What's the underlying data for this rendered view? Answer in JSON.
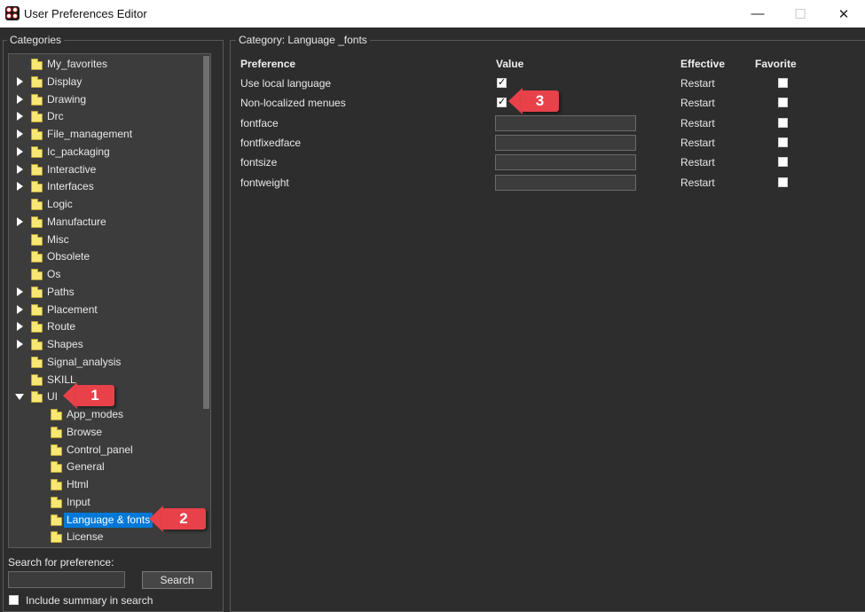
{
  "window": {
    "title": "User Preferences Editor",
    "minimize_glyph": "—",
    "maximize_glyph": "☐",
    "close_glyph": "✕"
  },
  "left_panel": {
    "group_title": "Categories",
    "tree": [
      {
        "label": "My_favorites",
        "expander": "none",
        "level": 0
      },
      {
        "label": "Display",
        "expander": "collapsed",
        "level": 0
      },
      {
        "label": "Drawing",
        "expander": "collapsed",
        "level": 0
      },
      {
        "label": "Drc",
        "expander": "collapsed",
        "level": 0
      },
      {
        "label": "File_management",
        "expander": "collapsed",
        "level": 0
      },
      {
        "label": "Ic_packaging",
        "expander": "collapsed",
        "level": 0
      },
      {
        "label": "Interactive",
        "expander": "collapsed",
        "level": 0
      },
      {
        "label": "Interfaces",
        "expander": "collapsed",
        "level": 0
      },
      {
        "label": "Logic",
        "expander": "none",
        "level": 0
      },
      {
        "label": "Manufacture",
        "expander": "collapsed",
        "level": 0
      },
      {
        "label": "Misc",
        "expander": "none",
        "level": 0
      },
      {
        "label": "Obsolete",
        "expander": "none",
        "level": 0
      },
      {
        "label": "Os",
        "expander": "none",
        "level": 0
      },
      {
        "label": "Paths",
        "expander": "collapsed",
        "level": 0
      },
      {
        "label": "Placement",
        "expander": "collapsed",
        "level": 0
      },
      {
        "label": "Route",
        "expander": "collapsed",
        "level": 0
      },
      {
        "label": "Shapes",
        "expander": "collapsed",
        "level": 0
      },
      {
        "label": "Signal_analysis",
        "expander": "none",
        "level": 0
      },
      {
        "label": "SKILL",
        "expander": "none",
        "level": 0
      },
      {
        "label": "UI",
        "expander": "expanded",
        "level": 0
      },
      {
        "label": "App_modes",
        "expander": "none",
        "level": 1
      },
      {
        "label": "Browse",
        "expander": "none",
        "level": 1
      },
      {
        "label": "Control_panel",
        "expander": "none",
        "level": 1
      },
      {
        "label": "General",
        "expander": "none",
        "level": 1
      },
      {
        "label": "Html",
        "expander": "none",
        "level": 1
      },
      {
        "label": "Input",
        "expander": "none",
        "level": 1
      },
      {
        "label": "Language & fonts",
        "expander": "none",
        "level": 1,
        "selected": true
      },
      {
        "label": "License",
        "expander": "none",
        "level": 1
      }
    ],
    "search_label": "Search for preference:",
    "search_value": "",
    "search_button": "Search",
    "include_summary_label": "Include summary in search",
    "include_summary_checked": false
  },
  "right_panel": {
    "category_label": "Category:  Language _fonts",
    "columns": {
      "preference": "Preference",
      "value": "Value",
      "effective": "Effective",
      "favorite": "Favorite"
    },
    "rows": [
      {
        "name": "Use local language",
        "type": "checkbox",
        "checked": true,
        "effective": "Restart",
        "favorite": false
      },
      {
        "name": "Non-localized menues",
        "type": "checkbox",
        "checked": true,
        "effective": "Restart",
        "favorite": false
      },
      {
        "name": "fontface",
        "type": "text",
        "value": "",
        "effective": "Restart",
        "favorite": false
      },
      {
        "name": "fontfixedface",
        "type": "text",
        "value": "",
        "effective": "Restart",
        "favorite": false
      },
      {
        "name": "fontsize",
        "type": "text",
        "value": "",
        "effective": "Restart",
        "favorite": false
      },
      {
        "name": "fontweight",
        "type": "text",
        "value": "",
        "effective": "Restart",
        "favorite": false
      }
    ]
  },
  "callouts": [
    {
      "number": "1"
    },
    {
      "number": "2"
    },
    {
      "number": "3"
    }
  ],
  "colors": {
    "selection": "#0078d7",
    "callout": "#e8414a",
    "folder": "#f7e774",
    "background": "#2d2d2d"
  }
}
